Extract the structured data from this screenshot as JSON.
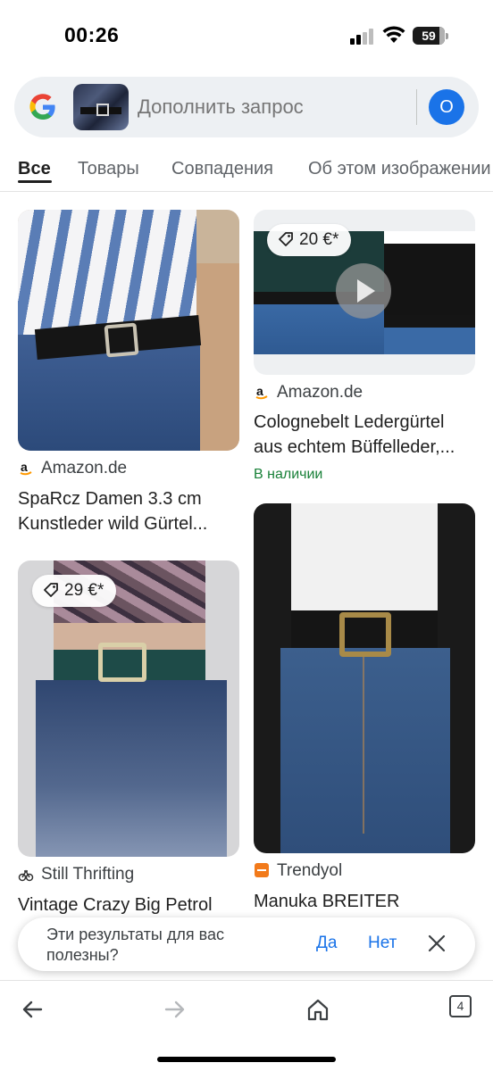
{
  "status_bar": {
    "time": "00:26",
    "battery": "59"
  },
  "search": {
    "placeholder": "Дополнить запрос",
    "avatar_letter": "O"
  },
  "tabs": [
    {
      "label": "Все",
      "active": true
    },
    {
      "label": "Товары"
    },
    {
      "label": "Совпадения"
    },
    {
      "label": "Об этом изображении"
    }
  ],
  "results": [
    {
      "source": "Amazon.de",
      "title_line1": "SpaRcz Damen 3.3 cm",
      "title_line2": "Kunstleder wild Gürtel..."
    },
    {
      "price": "20 €*",
      "source": "Amazon.de",
      "title_line1": "Colognebelt Ledergürtel",
      "title_line2": "aus echtem Büffelleder,...",
      "stock": "В наличии"
    },
    {
      "price": "29 €*",
      "source": "Still Thrifting",
      "title_line1": "Vintage Crazy Big Petrol"
    },
    {
      "source": "Trendyol",
      "title_line1": "Manuka BREITER"
    }
  ],
  "feedback": {
    "text": "Эти результаты для вас полезны?",
    "yes": "Да",
    "no": "Нет"
  },
  "bottom_bar": {
    "tab_count": "4"
  },
  "colors": {
    "accent": "#1a73e8",
    "in_stock": "#188038",
    "search_bg": "#edf0f3"
  },
  "icons": [
    "google-logo-icon",
    "tag-icon",
    "play-icon",
    "amazon-icon",
    "still-thrifting-icon",
    "trendyol-icon",
    "close-icon",
    "back-arrow-icon",
    "forward-arrow-icon",
    "home-icon",
    "tabs-icon"
  ]
}
